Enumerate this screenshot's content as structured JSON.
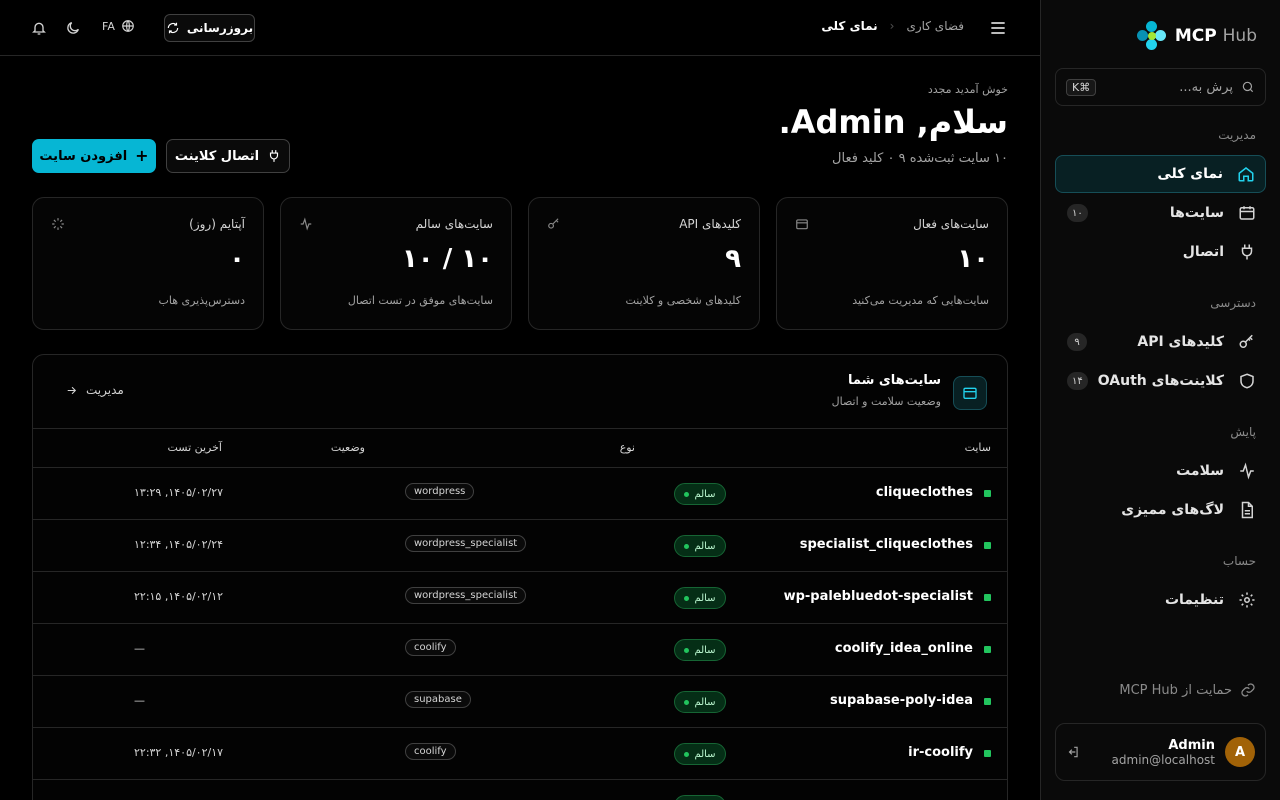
{
  "brand": {
    "name": "MCP",
    "suffix": "Hub"
  },
  "search": {
    "placeholder": "پرش به...",
    "shortcut": "K⌘"
  },
  "sidebar": {
    "sections": {
      "management": "مدیریت",
      "access": "دسترسی",
      "monitoring": "پایش",
      "account": "حساب"
    },
    "items": [
      {
        "label": "نمای کلی"
      },
      {
        "label": "سایت‌ها",
        "count": "۱۰"
      },
      {
        "label": "اتصال"
      },
      {
        "label": "کلیدهای API",
        "count": "۹"
      },
      {
        "label": "کلاینت‌های OAuth",
        "count": "۱۴"
      },
      {
        "label": "سلامت"
      },
      {
        "label": "لاگ‌های ممیزی"
      },
      {
        "label": "تنظیمات"
      }
    ],
    "support": "حمایت از MCP Hub",
    "user": {
      "initial": "A",
      "name": "Admin",
      "email": "admin@localhost"
    }
  },
  "header": {
    "breadcrumb_root": "فضای کاری",
    "breadcrumb_current": "نمای کلی",
    "refresh_label": "بروزرسانی",
    "lang": "FA"
  },
  "main": {
    "welcome": "خوش آمدید مجدد",
    "hello": "سلام, Admin.",
    "summary": "۱۰ سایت ثبت‌شده ۹ ۰ کلید فعال",
    "add_site": "افزودن سایت",
    "connect_client": "اتصال کلاینت",
    "stats": [
      {
        "title": "سایت‌های فعال",
        "value": "۱۰",
        "sub": "سایت‌هایی که مدیریت می‌کنید",
        "icon": "calendar-icon"
      },
      {
        "title": "کلیدهای API",
        "value": "۹",
        "sub": "کلیدهای شخصی و کلاینت",
        "icon": "key-icon"
      },
      {
        "title": "سایت‌های سالم",
        "value": "۱۰ / ۱۰",
        "sub": "سایت‌های موفق در تست اتصال",
        "icon": "activity-icon"
      },
      {
        "title": "آپتایم (روز)",
        "value": "۰",
        "sub": "دسترس‌پذیری هاب",
        "icon": "loader-icon"
      }
    ],
    "sites_panel": {
      "title": "سایت‌های شما",
      "subtitle": "وضعیت سلامت و اتصال",
      "manage": "مدیریت",
      "columns": {
        "site": "سایت",
        "type": "نوع",
        "status": "وضعیت",
        "last_test": "آخرین تست"
      },
      "rows": [
        {
          "name": "cliqueclothes",
          "type": "wordpress",
          "status": "سالم",
          "last_test": "۱۴۰۵/۰۲/۲۷, ۱۳:۲۹"
        },
        {
          "name": "specialist_cliqueclothes",
          "type": "wordpress_specialist",
          "status": "سالم",
          "last_test": "۱۴۰۵/۰۲/۲۴, ۱۲:۳۴"
        },
        {
          "name": "wp-palebluedot-specialist",
          "type": "wordpress_specialist",
          "status": "سالم",
          "last_test": "۱۴۰۵/۰۲/۱۲, ۲۲:۱۵"
        },
        {
          "name": "coolify_idea_online",
          "type": "coolify",
          "status": "سالم",
          "last_test": "—"
        },
        {
          "name": "supabase-poly-idea",
          "type": "supabase",
          "status": "سالم",
          "last_test": "—"
        },
        {
          "name": "ir-coolify",
          "type": "coolify",
          "status": "سالم",
          "last_test": "۱۴۰۵/۰۲/۱۷, ۲۲:۳۲"
        },
        {
          "name": "",
          "type": "",
          "status": "",
          "last_test": ""
        }
      ]
    }
  },
  "colors": {
    "accent": "#06b6d4",
    "healthy": "#22c55e",
    "background": "#000000"
  }
}
